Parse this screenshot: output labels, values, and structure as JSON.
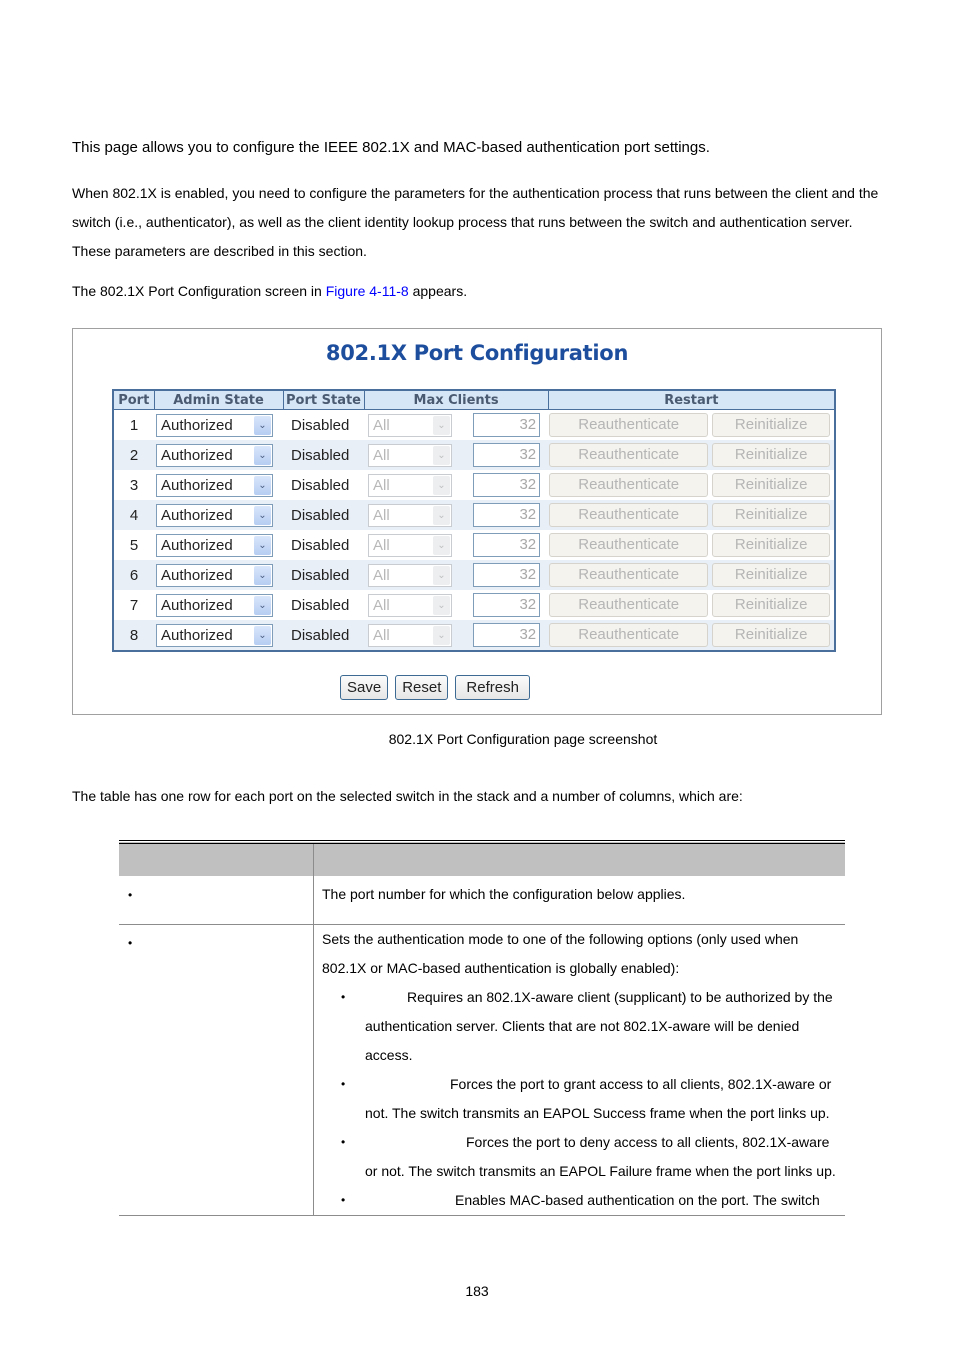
{
  "intro": "This page allows you to configure the IEEE 802.1X and MAC-based authentication port settings.",
  "paragraph": "When 802.1X is enabled, you need to configure the parameters for the authentication process that runs between the client and the switch (i.e., authenticator), as well as the client identity lookup process that runs between the switch and authentication server. These parameters are described in this section.",
  "figure_ref": {
    "before": "The 802.1X Port Configuration screen in ",
    "link": "Figure 4-11-8",
    "after": " appears."
  },
  "screenshot": {
    "title": "802.1X Port Configuration",
    "headers": {
      "port": "Port",
      "admin_state": "Admin State",
      "port_state": "Port State",
      "max_clients": "Max Clients",
      "restart": "Restart"
    },
    "rows": [
      {
        "port": "1",
        "admin_state": "Authorized",
        "port_state": "Disabled",
        "mode": "All",
        "max_clients": "32",
        "reauth": "Reauthenticate",
        "reinit": "Reinitialize"
      },
      {
        "port": "2",
        "admin_state": "Authorized",
        "port_state": "Disabled",
        "mode": "All",
        "max_clients": "32",
        "reauth": "Reauthenticate",
        "reinit": "Reinitialize"
      },
      {
        "port": "3",
        "admin_state": "Authorized",
        "port_state": "Disabled",
        "mode": "All",
        "max_clients": "32",
        "reauth": "Reauthenticate",
        "reinit": "Reinitialize"
      },
      {
        "port": "4",
        "admin_state": "Authorized",
        "port_state": "Disabled",
        "mode": "All",
        "max_clients": "32",
        "reauth": "Reauthenticate",
        "reinit": "Reinitialize"
      },
      {
        "port": "5",
        "admin_state": "Authorized",
        "port_state": "Disabled",
        "mode": "All",
        "max_clients": "32",
        "reauth": "Reauthenticate",
        "reinit": "Reinitialize"
      },
      {
        "port": "6",
        "admin_state": "Authorized",
        "port_state": "Disabled",
        "mode": "All",
        "max_clients": "32",
        "reauth": "Reauthenticate",
        "reinit": "Reinitialize"
      },
      {
        "port": "7",
        "admin_state": "Authorized",
        "port_state": "Disabled",
        "mode": "All",
        "max_clients": "32",
        "reauth": "Reauthenticate",
        "reinit": "Reinitialize"
      },
      {
        "port": "8",
        "admin_state": "Authorized",
        "port_state": "Disabled",
        "mode": "All",
        "max_clients": "32",
        "reauth": "Reauthenticate",
        "reinit": "Reinitialize"
      }
    ],
    "buttons": {
      "save": "Save",
      "reset": "Reset",
      "refresh": "Refresh"
    }
  },
  "caption": "802.1X Port Configuration page screenshot",
  "table_intro": "The table has one row for each port on the selected switch in the stack and a number of columns, which are:",
  "desc_table": {
    "header": [
      "",
      ""
    ],
    "rows": [
      {
        "bullet": "•",
        "description": "The port number for which the configuration below applies."
      },
      {
        "bullet": "•",
        "description": "Sets the authentication mode to one of the following options (only used when 802.1X or MAC-based authentication is globally enabled):",
        "options": [
          {
            "bullet": "•",
            "text": "Requires an 802.1X-aware client (supplicant) to be authorized by the authentication server. Clients that are not 802.1X-aware will be denied access."
          },
          {
            "bullet": "•",
            "text": "Forces the port to grant access to all clients, 802.1X-aware or not. The switch transmits an EAPOL Success frame when the port links up."
          },
          {
            "bullet": "•",
            "text": "Forces the port to deny access to all clients, 802.1X-aware or not. The switch transmits an EAPOL Failure frame when the port links up."
          },
          {
            "bullet": "•",
            "text": "Enables MAC-based authentication on the port. The switch"
          }
        ]
      }
    ]
  },
  "page_number": "183",
  "colors": {
    "title_blue": "#1d4e9e",
    "table_border": "#4a6f9c",
    "header_bg": "#d7e6f7",
    "row_alt_bg": "#e9eff6",
    "link": "#0000ff",
    "desc_header_bg": "#c0c0c0"
  }
}
